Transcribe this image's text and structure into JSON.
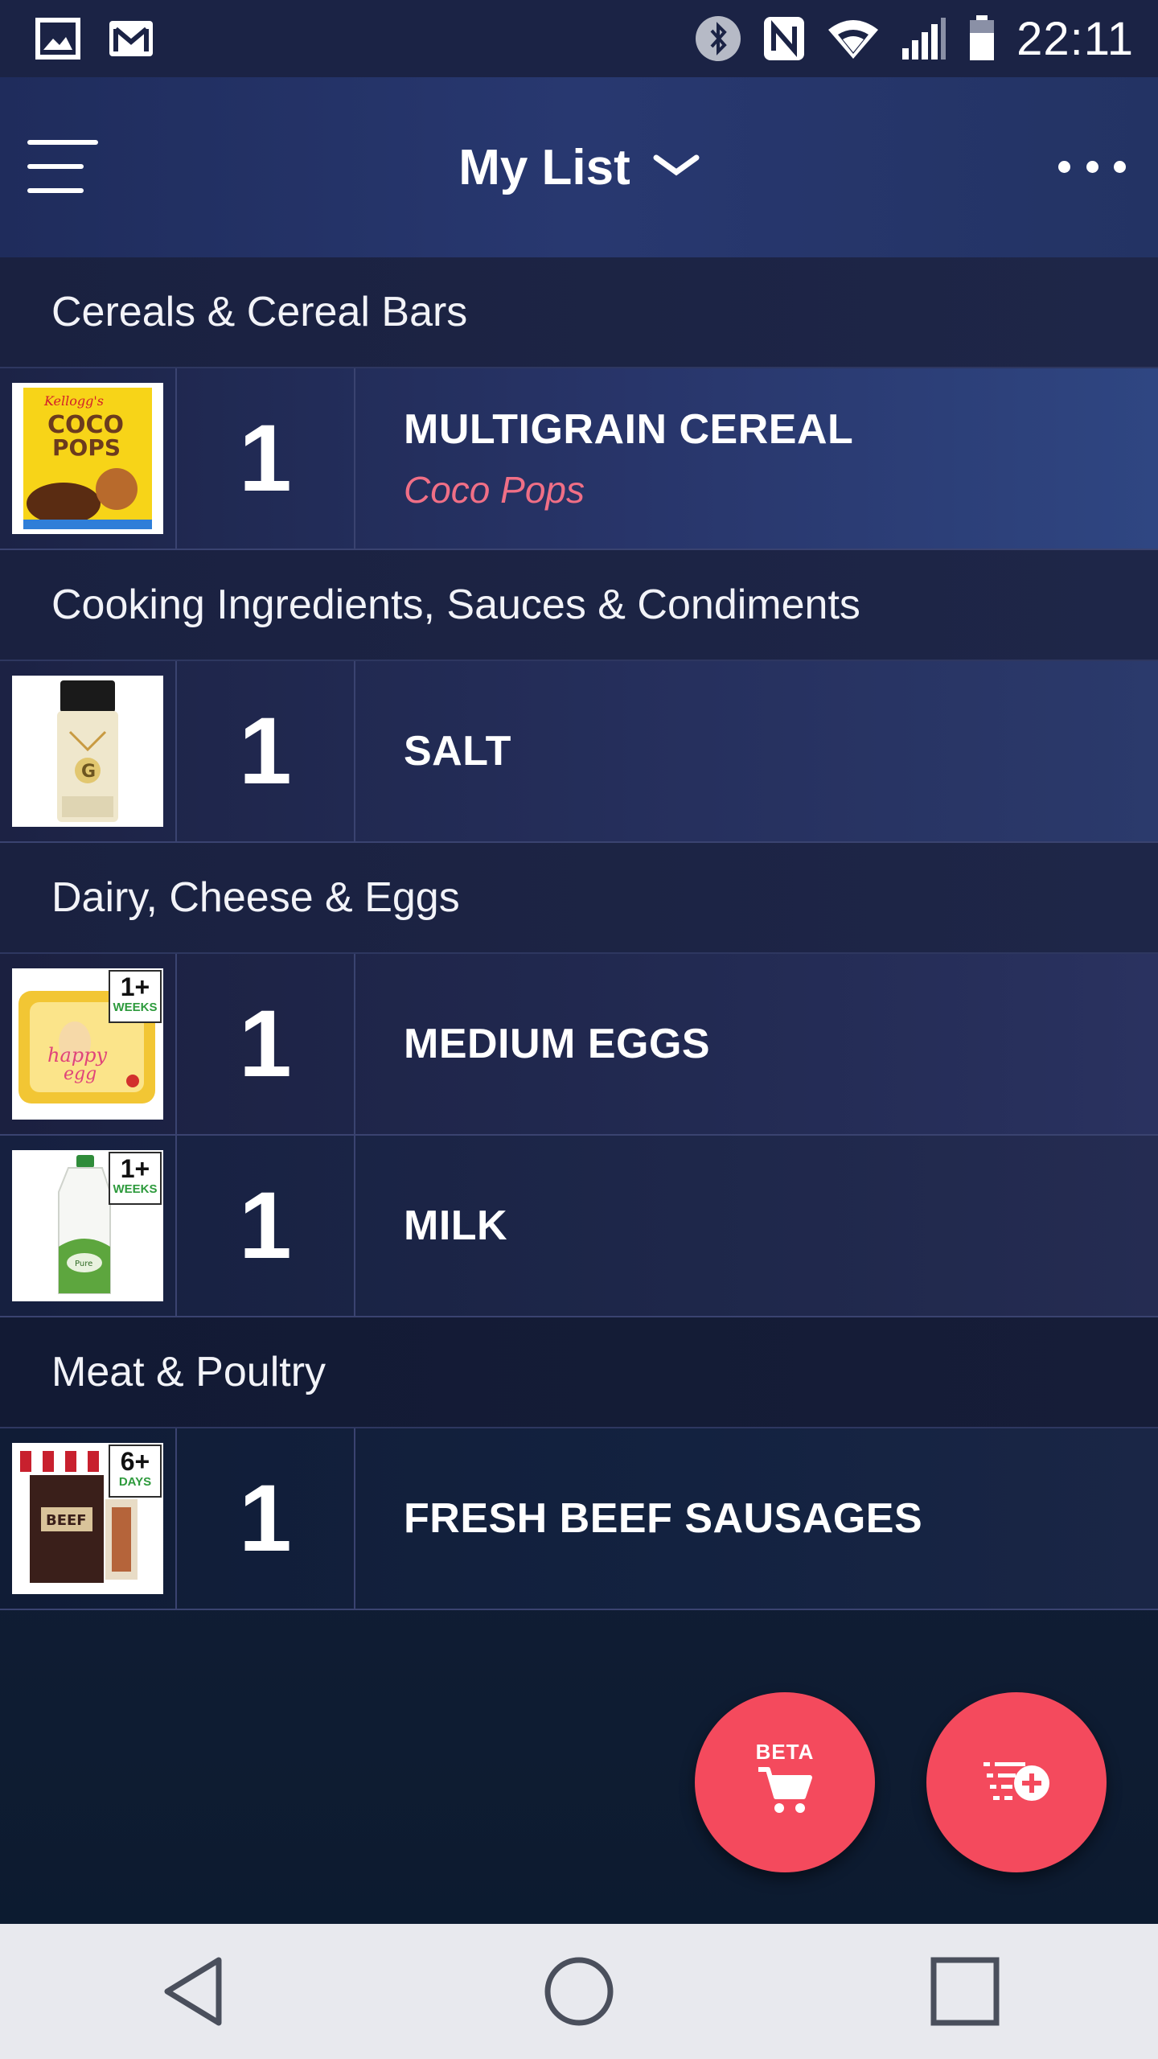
{
  "status_bar": {
    "time": "22:11",
    "icons": [
      "gallery-icon",
      "gmail-icon",
      "bluetooth-icon",
      "nfc-icon",
      "wifi-icon",
      "signal-icon",
      "battery-icon"
    ]
  },
  "app_bar": {
    "title": "My List",
    "icons": [
      "hamburger-menu-icon",
      "chevron-down-icon",
      "more-options-icon"
    ]
  },
  "sections": [
    {
      "header": "Cereals & Cereal Bars",
      "items": [
        {
          "qty": "1",
          "name": "MULTIGRAIN CEREAL",
          "subtitle": "Coco Pops"
        }
      ]
    },
    {
      "header": "Cooking Ingredients, Sauces & Condiments",
      "items": [
        {
          "qty": "1",
          "name": "SALT"
        }
      ]
    },
    {
      "header": "Dairy, Cheese & Eggs",
      "items": [
        {
          "qty": "1",
          "name": "MEDIUM EGGS",
          "badge": {
            "value": "1+",
            "unit": "WEEKS"
          }
        },
        {
          "qty": "1",
          "name": "MILK",
          "badge": {
            "value": "1+",
            "unit": "WEEKS"
          }
        }
      ]
    },
    {
      "header": "Meat & Poultry",
      "items": [
        {
          "qty": "1",
          "name": "FRESH BEEF SAUSAGES",
          "badge": {
            "value": "6+",
            "unit": "DAYS"
          }
        }
      ]
    }
  ],
  "fabs": {
    "scan_label": "BETA"
  },
  "colors": {
    "accent": "#f44a5d",
    "subtitle": "#f06f86",
    "app_bar": "#283870"
  }
}
